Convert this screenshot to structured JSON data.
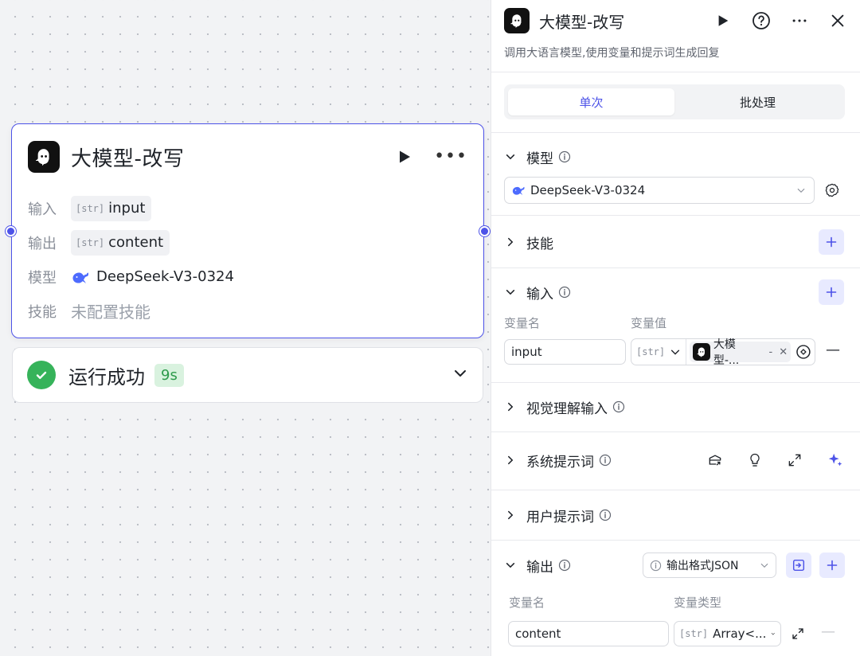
{
  "node": {
    "title": "大模型-改写",
    "rows": [
      {
        "label": "输入",
        "tag": "[str]",
        "value": "input"
      },
      {
        "label": "输出",
        "tag": "[str]",
        "value": "content"
      },
      {
        "label": "模型",
        "value": "DeepSeek-V3-0324"
      },
      {
        "label": "技能",
        "value": "未配置技能"
      }
    ]
  },
  "status": {
    "text": "运行成功",
    "duration": "9s"
  },
  "panel": {
    "title": "大模型-改写",
    "description": "调用大语言模型,使用变量和提示词生成回复",
    "tabs": [
      {
        "label": "单次",
        "active": true
      },
      {
        "label": "批处理",
        "active": false
      }
    ],
    "sections": {
      "model": "模型",
      "skills": "技能",
      "input": "输入",
      "vision": "视觉理解输入",
      "system_prompt": "系统提示词",
      "user_prompt": "用户提示词",
      "output": "输出"
    },
    "model_selected": "DeepSeek-V3-0324",
    "input_table": {
      "col_name": "变量名",
      "col_value": "变量值",
      "rows": [
        {
          "name": "input",
          "type_tag": "[str]",
          "ref_text": "大模型-...",
          "ref_suffix": "-"
        }
      ]
    },
    "output_format": "输出格式JSON",
    "output_table": {
      "col_name": "变量名",
      "col_type": "变量类型",
      "rows": [
        {
          "name": "content",
          "type_tag": "[str]",
          "type": "Array<..."
        }
      ]
    }
  },
  "colors": {
    "accent": "#4d53e8",
    "success": "#36b35a",
    "accent_bg": "#e8eaff"
  }
}
